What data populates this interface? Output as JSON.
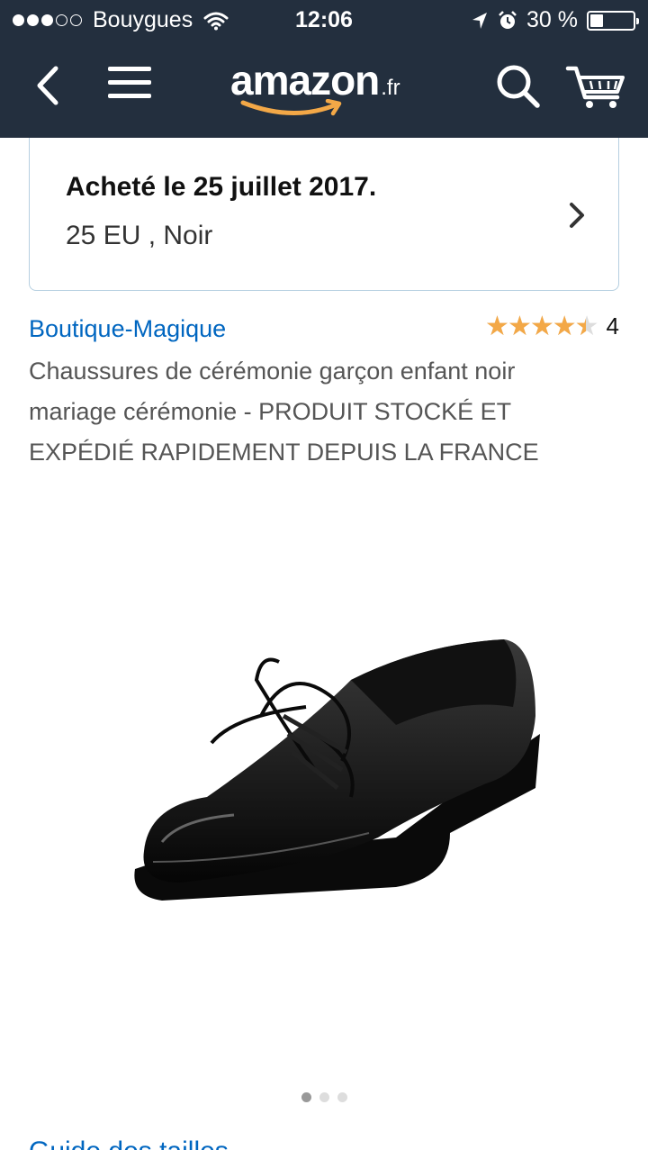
{
  "status_bar": {
    "carrier": "Bouygues",
    "time": "12:06",
    "battery": "30 %",
    "battery_level": 0.3
  },
  "nav": {
    "logo_text": "amazon",
    "logo_tld": ".fr",
    "icons": [
      "back-icon",
      "menu-icon",
      "search-icon",
      "cart-icon"
    ]
  },
  "purchase": {
    "title": "Acheté le 25 juillet 2017.",
    "details": "25 EU , Noir"
  },
  "product": {
    "brand": "Boutique-Magique",
    "rating": 4.5,
    "rating_count": "4",
    "title": "Chaussures de cérémonie garçon enfant noir mariage cérémonie - PRODUIT STOCKÉ ET EXPÉDIÉ RAPIDEMENT DEPUIS LA FRANCE"
  },
  "carousel": {
    "count": 3,
    "active": 1
  },
  "links": {
    "size_guide": "Guide des tailles"
  },
  "colors": {
    "header_bg": "#232f3e",
    "link": "#0066c0",
    "star": "#f3a847",
    "card_border": "#b5cfe0"
  }
}
